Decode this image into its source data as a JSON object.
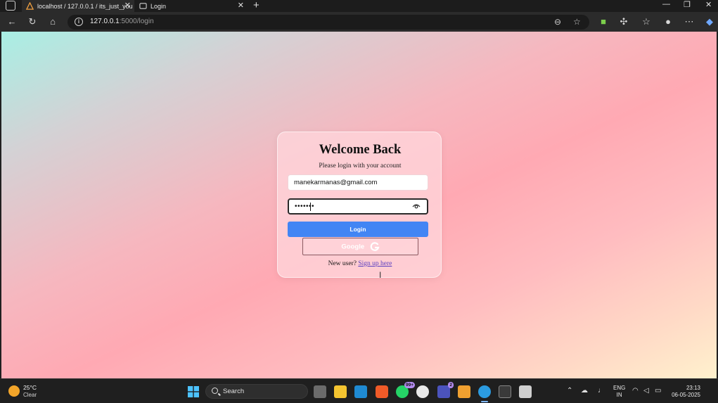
{
  "browser": {
    "tabs": [
      {
        "title": "localhost / 127.0.0.1 / its_just_you",
        "active": false
      },
      {
        "title": "Login",
        "active": true
      }
    ],
    "address": {
      "host": "127.0.0.1",
      "path": ":5000/login"
    }
  },
  "page": {
    "title": "Welcome Back",
    "subtitle": "Please login with your account",
    "email_value": "manekarmanas@gmail.com",
    "password_value": "•••••••",
    "login_label": "Login",
    "google_label": "Google",
    "signup_prompt": "New user?",
    "signup_link": "Sign up here",
    "colors": {
      "login_button": "#4285f4",
      "link": "#5a3fc0"
    }
  },
  "taskbar": {
    "weather_temp": "25°C",
    "weather_cond": "Clear",
    "search_label": "Search",
    "whatsapp_badge": "99+",
    "teams_badge": "2",
    "lang_top": "ENG",
    "lang_bottom": "IN",
    "time": "23:13",
    "date": "06-05-2025"
  }
}
